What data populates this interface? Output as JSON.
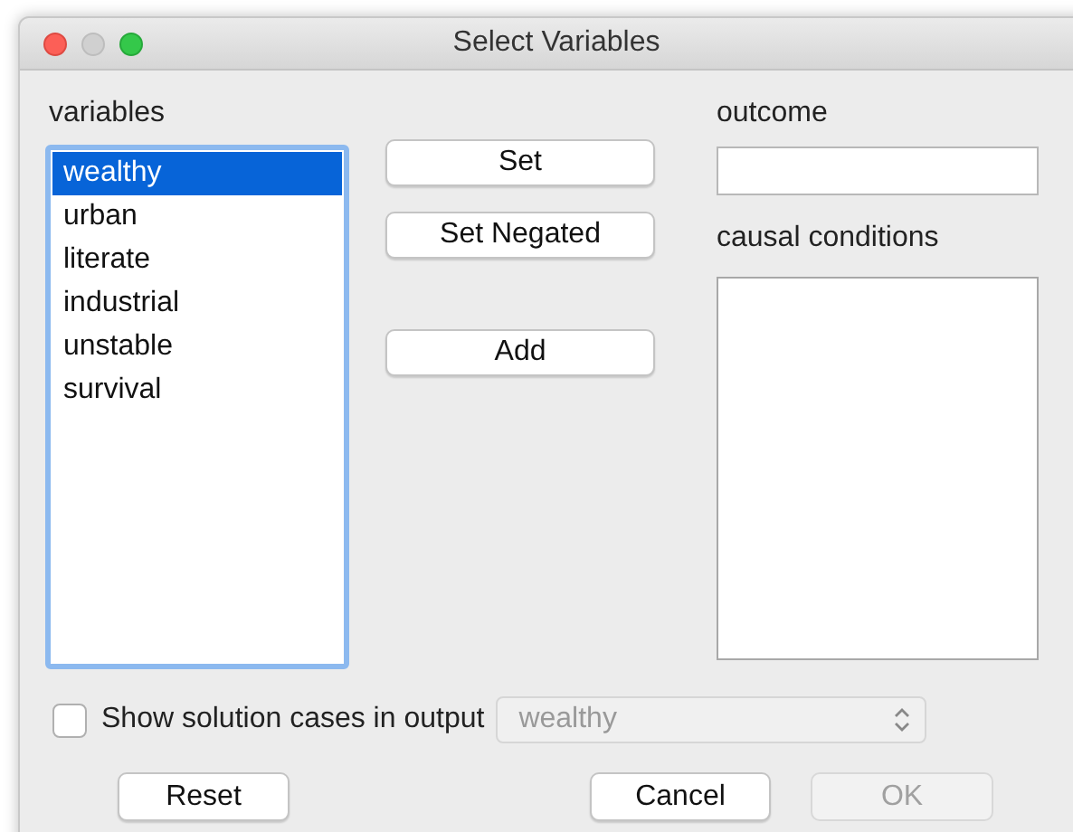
{
  "window": {
    "title": "Select Variables"
  },
  "variables": {
    "label": "variables",
    "items": [
      {
        "label": "wealthy",
        "selected": true
      },
      {
        "label": "urban",
        "selected": false
      },
      {
        "label": "literate",
        "selected": false
      },
      {
        "label": "industrial",
        "selected": false
      },
      {
        "label": "unstable",
        "selected": false
      },
      {
        "label": "survival",
        "selected": false
      }
    ]
  },
  "middle_buttons": [
    {
      "label": "Set"
    },
    {
      "label": "Set Negated"
    },
    {
      "label": "Add"
    }
  ],
  "outcome": {
    "label": "outcome"
  },
  "causal_conditions": {
    "label": "causal conditions"
  },
  "show_solution_cases": {
    "label": "Show solution cases in output",
    "checked": false
  },
  "case_dropdown": {
    "value": "wealthy",
    "disabled": true
  },
  "footer_buttons": [
    {
      "label": "Reset",
      "disabled": false
    },
    {
      "label": "Cancel",
      "disabled": false
    },
    {
      "label": "OK",
      "disabled": true
    }
  ]
}
